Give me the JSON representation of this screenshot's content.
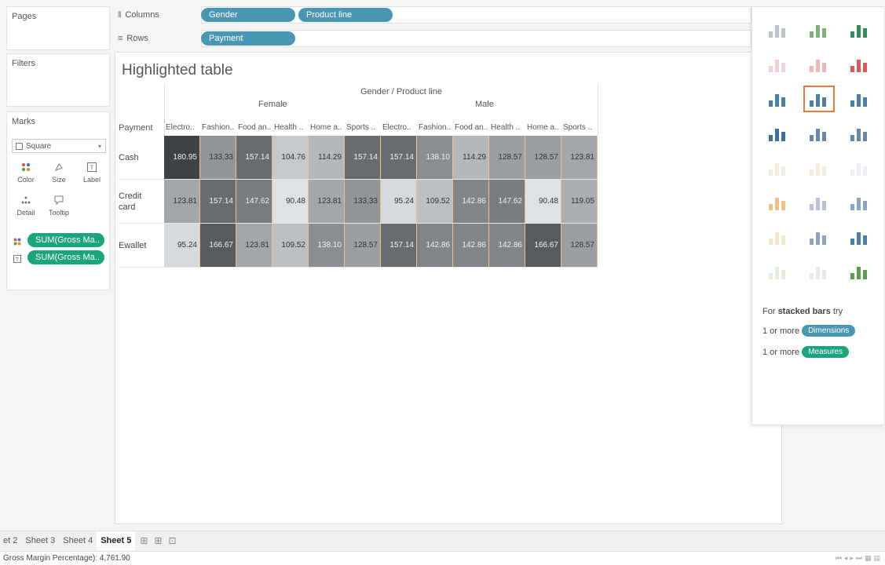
{
  "panels": {
    "pages": "Pages",
    "filters": "Filters",
    "marks": "Marks"
  },
  "marks": {
    "type": "Square",
    "buttons": {
      "color": "Color",
      "size": "Size",
      "label": "Label",
      "detail": "Detail",
      "tooltip": "Tooltip"
    },
    "pills": [
      "SUM(Gross Ma..",
      "SUM(Gross Ma.."
    ]
  },
  "shelves": {
    "columns_label": "Columns",
    "rows_label": "Rows",
    "columns": [
      "Gender",
      "Product line"
    ],
    "rows": [
      "Payment"
    ]
  },
  "view": {
    "title": "Highlighted table",
    "header_title": "Gender / Product line",
    "groups": [
      "Female",
      "Male"
    ],
    "row_header": "Payment",
    "columns": [
      "Electro..",
      "Fashion..",
      "Food an..",
      "Health ..",
      "Home a..",
      "Sports ..",
      "Electro..",
      "Fashion..",
      "Food an..",
      "Health ..",
      "Home a..",
      "Sports .."
    ],
    "row_labels": [
      "Cash",
      "Credit card",
      "Ewallet"
    ],
    "rows": [
      {
        "label": "Cash",
        "values": [
          "180.95",
          "133.33",
          "157.14",
          "104.76",
          "114.29",
          "157.14",
          "157.14",
          "138.10",
          "114.29",
          "128.57",
          "128.57",
          "123.81"
        ]
      },
      {
        "label": "Credit card",
        "values": [
          "123.81",
          "157.14",
          "147.62",
          "90.48",
          "123.81",
          "133.33",
          "95.24",
          "109.52",
          "142.86",
          "147.62",
          "90.48",
          "119.05"
        ]
      },
      {
        "label": "Ewallet",
        "values": [
          "95.24",
          "166.67",
          "123.81",
          "109.52",
          "138.10",
          "128.57",
          "157.14",
          "142.86",
          "142.86",
          "142.86",
          "166.67",
          "128.57"
        ]
      }
    ]
  },
  "show_me": {
    "hint_prefix": "For ",
    "hint_bold": "stacked bars",
    "hint_suffix": " try",
    "line1_prefix": "1 or more",
    "line1_pill": "Dimensions",
    "line2_prefix": "1 or more",
    "line2_pill": "Measures"
  },
  "tabs": [
    "et 2",
    "Sheet 3",
    "Sheet 4",
    "Sheet 5"
  ],
  "active_tab": "Sheet 5",
  "status_text": "Gross Margin Percentage): 4,761.90",
  "colors": {
    "dimension_pill": "#4a97b3",
    "measure_pill": "#1aa57a",
    "selected_chart": "#e07b39"
  }
}
